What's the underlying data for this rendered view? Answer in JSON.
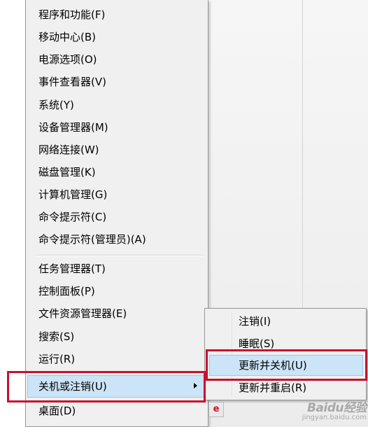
{
  "main_menu": {
    "items": [
      {
        "label": "程序和功能(F)"
      },
      {
        "label": "移动中心(B)"
      },
      {
        "label": "电源选项(O)"
      },
      {
        "label": "事件查看器(V)"
      },
      {
        "label": "系统(Y)"
      },
      {
        "label": "设备管理器(M)"
      },
      {
        "label": "网络连接(W)"
      },
      {
        "label": "磁盘管理(K)"
      },
      {
        "label": "计算机管理(G)"
      },
      {
        "label": "命令提示符(C)"
      },
      {
        "label": "命令提示符(管理员)(A)"
      },
      {
        "label": "任务管理器(T)"
      },
      {
        "label": "控制面板(P)"
      },
      {
        "label": "文件资源管理器(E)"
      },
      {
        "label": "搜索(S)"
      },
      {
        "label": "运行(R)"
      },
      {
        "label": "关机或注销(U)"
      },
      {
        "label": "桌面(D)"
      }
    ],
    "highlighted_item": "关机或注销(U)"
  },
  "submenu": {
    "items": [
      {
        "label": "注销(I)"
      },
      {
        "label": "睡眠(S)"
      },
      {
        "label": "更新并关机(U)"
      },
      {
        "label": "更新并重启(R)"
      }
    ],
    "highlighted_item": "更新并关机(U)"
  },
  "watermark": {
    "logo": "Baidu经验",
    "url": "jingyan.baidu.com"
  },
  "taskbar_icon_glyph": "e",
  "colors": {
    "menu_bg": "#f0f0f0",
    "highlight": "#cce4f7",
    "highlight_border": "#99c9ef",
    "annotation": "#c8102e"
  }
}
